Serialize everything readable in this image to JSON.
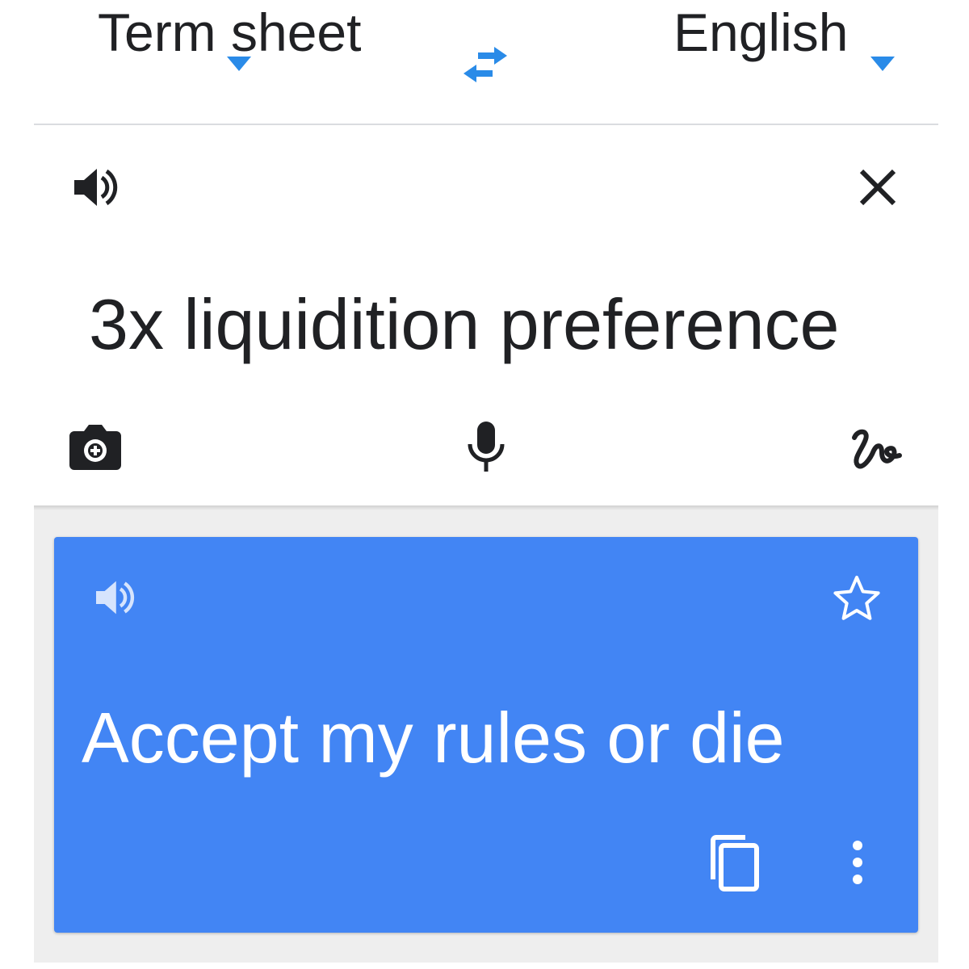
{
  "language_bar": {
    "source_language": "Term sheet",
    "target_language": "English",
    "swap_icon": "swap-arrows-icon",
    "dropdown_icon": "dropdown-triangle-icon"
  },
  "source_panel": {
    "text": "3x liquidition preference",
    "listen_icon": "speaker-icon",
    "clear_icon": "close-icon",
    "camera_icon": "camera-icon",
    "voice_icon": "microphone-icon",
    "handwriting_icon": "handwriting-icon"
  },
  "result_panel": {
    "text": "Accept my rules or die",
    "listen_icon": "speaker-icon",
    "save_icon": "star-outline-icon",
    "copy_icon": "copy-icon",
    "more_icon": "more-vert-icon"
  },
  "colors": {
    "accent": "#4285f4",
    "text_primary": "#202124",
    "panel_background": "#eeeeee",
    "result_text": "#ffffff"
  }
}
